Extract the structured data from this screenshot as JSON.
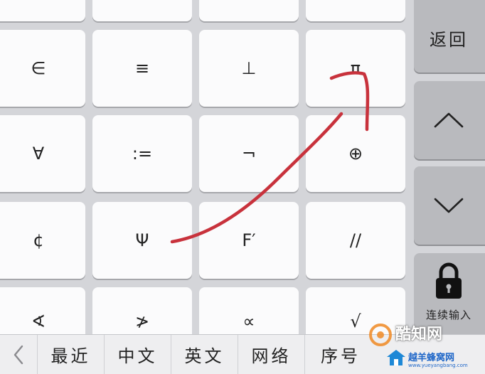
{
  "keyboard": {
    "rows": [
      [
        "∈",
        "≡",
        "⊥",
        "π"
      ],
      [
        "∀",
        ":=",
        "¬",
        "⊕"
      ],
      [
        "¢",
        "Ψ",
        "F′",
        "//"
      ],
      [
        "∢",
        "≯",
        "∝",
        "√"
      ]
    ],
    "side": {
      "back_label": "返回",
      "up_icon": "chevron-up-icon",
      "down_icon": "chevron-down-icon",
      "lock_icon": "lock-icon",
      "continuous_label": "连续输入"
    }
  },
  "bottom_bar": {
    "back_icon": "chevron-left-icon",
    "tabs": [
      "最近",
      "中文",
      "英文",
      "网络",
      "序号"
    ]
  },
  "watermark": {
    "brand_top": "酷知网",
    "brand_bottom": "越羊蜂窝网",
    "url": "www.yueyangbang.com"
  },
  "colors": {
    "key": "#fbfbfc",
    "side_key": "#b9babe",
    "background": "#d4d5d9",
    "stroke": "#c8323c"
  }
}
